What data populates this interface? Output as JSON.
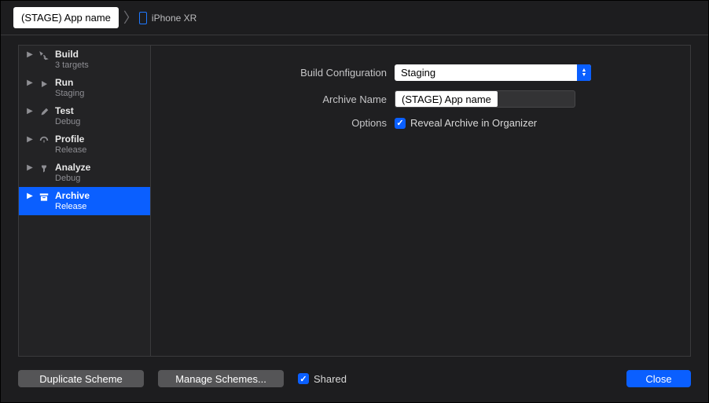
{
  "breadcrumb": {
    "app": "(STAGE) App name",
    "device": "iPhone XR"
  },
  "sidebar": {
    "items": [
      {
        "title": "Build",
        "sub": "3 targets"
      },
      {
        "title": "Run",
        "sub": "Staging"
      },
      {
        "title": "Test",
        "sub": "Debug"
      },
      {
        "title": "Profile",
        "sub": "Release"
      },
      {
        "title": "Analyze",
        "sub": "Debug"
      },
      {
        "title": "Archive",
        "sub": "Release"
      }
    ]
  },
  "form": {
    "build_config_label": "Build Configuration",
    "build_config_value": "Staging",
    "archive_name_label": "Archive Name",
    "archive_name_value": "(STAGE) App name",
    "options_label": "Options",
    "reveal_label": "Reveal Archive in Organizer",
    "reveal_checked": true
  },
  "footer": {
    "dup": "Duplicate Scheme",
    "manage": "Manage Schemes...",
    "shared_label": "Shared",
    "shared_checked": true,
    "close": "Close"
  }
}
